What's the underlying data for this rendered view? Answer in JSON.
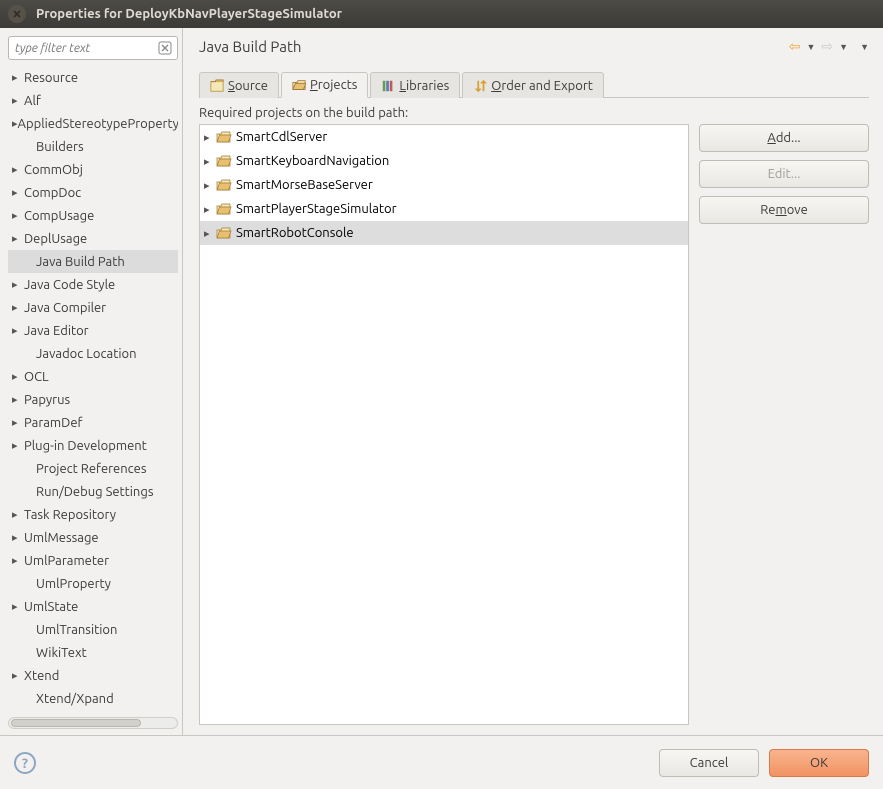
{
  "window": {
    "title": "Properties for DeployKbNavPlayerStageSimulator"
  },
  "sidebar": {
    "filter_placeholder": "type filter text",
    "items": [
      {
        "label": "Resource",
        "expandable": true
      },
      {
        "label": "Alf",
        "expandable": true
      },
      {
        "label": "AppliedStereotypeProperty",
        "expandable": true
      },
      {
        "label": "Builders",
        "expandable": false,
        "child": true
      },
      {
        "label": "CommObj",
        "expandable": true
      },
      {
        "label": "CompDoc",
        "expandable": true
      },
      {
        "label": "CompUsage",
        "expandable": true
      },
      {
        "label": "DeplUsage",
        "expandable": true
      },
      {
        "label": "Java Build Path",
        "expandable": false,
        "child": true,
        "selected": true
      },
      {
        "label": "Java Code Style",
        "expandable": true
      },
      {
        "label": "Java Compiler",
        "expandable": true
      },
      {
        "label": "Java Editor",
        "expandable": true
      },
      {
        "label": "Javadoc Location",
        "expandable": false,
        "child": true
      },
      {
        "label": "OCL",
        "expandable": true
      },
      {
        "label": "Papyrus",
        "expandable": true
      },
      {
        "label": "ParamDef",
        "expandable": true
      },
      {
        "label": "Plug-in Development",
        "expandable": true
      },
      {
        "label": "Project References",
        "expandable": false,
        "child": true
      },
      {
        "label": "Run/Debug Settings",
        "expandable": false,
        "child": true
      },
      {
        "label": "Task Repository",
        "expandable": true
      },
      {
        "label": "UmlMessage",
        "expandable": true
      },
      {
        "label": "UmlParameter",
        "expandable": true
      },
      {
        "label": "UmlProperty",
        "expandable": false,
        "child": true
      },
      {
        "label": "UmlState",
        "expandable": true
      },
      {
        "label": "UmlTransition",
        "expandable": false,
        "child": true
      },
      {
        "label": "WikiText",
        "expandable": false,
        "child": true
      },
      {
        "label": "Xtend",
        "expandable": true
      },
      {
        "label": "Xtend/Xpand",
        "expandable": false,
        "child": true
      }
    ]
  },
  "content": {
    "title": "Java Build Path",
    "tabs": [
      {
        "key": "source",
        "label": "Source",
        "mn": "S"
      },
      {
        "key": "projects",
        "label": "Projects",
        "mn": "P",
        "active": true
      },
      {
        "key": "libraries",
        "label": "Libraries",
        "mn": "L"
      },
      {
        "key": "order",
        "label": "Order and Export",
        "mn": "O"
      }
    ],
    "required_label": "Required projects on the build path:",
    "projects": [
      {
        "label": "SmartCdlServer"
      },
      {
        "label": "SmartKeyboardNavigation"
      },
      {
        "label": "SmartMorseBaseServer"
      },
      {
        "label": "SmartPlayerStageSimulator"
      },
      {
        "label": "SmartRobotConsole",
        "selected": true
      }
    ],
    "buttons": {
      "add": "Add...",
      "edit": "Edit...",
      "remove": "Remove"
    }
  },
  "footer": {
    "cancel": "Cancel",
    "ok": "OK"
  }
}
